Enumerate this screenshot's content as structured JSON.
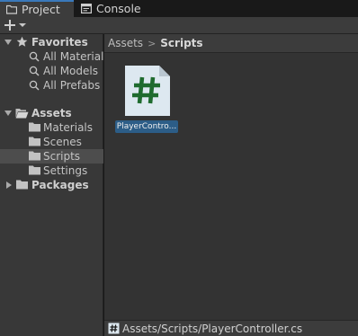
{
  "tabs": {
    "project": "Project",
    "console": "Console"
  },
  "toolbar": {
    "add_icon": "plus-icon",
    "dropdown_icon": "caret-down-icon"
  },
  "tree": {
    "favorites": {
      "label": "Favorites",
      "icon": "star-icon",
      "items": [
        "All Materials",
        "All Models",
        "All Prefabs"
      ]
    },
    "assets": {
      "label": "Assets",
      "icon": "folder-open-icon",
      "items": [
        "Materials",
        "Scenes",
        "Scripts",
        "Settings"
      ],
      "selected": "Scripts"
    },
    "packages": {
      "label": "Packages",
      "icon": "folder-icon"
    }
  },
  "breadcrumb": {
    "root": "Assets",
    "separator": ">",
    "current": "Scripts"
  },
  "asset_grid": {
    "items": [
      {
        "label": "PlayerContro...",
        "icon": "csharp-script-icon"
      }
    ]
  },
  "statusbar": {
    "path": "Assets/Scripts/PlayerController.cs",
    "icon": "csharp-script-icon"
  },
  "colors": {
    "selection": "#2c5d87",
    "active_tab_accent": "#3a79bb",
    "script_icon_fill": "#dde8f0",
    "script_hash": "#1f6b2e"
  }
}
